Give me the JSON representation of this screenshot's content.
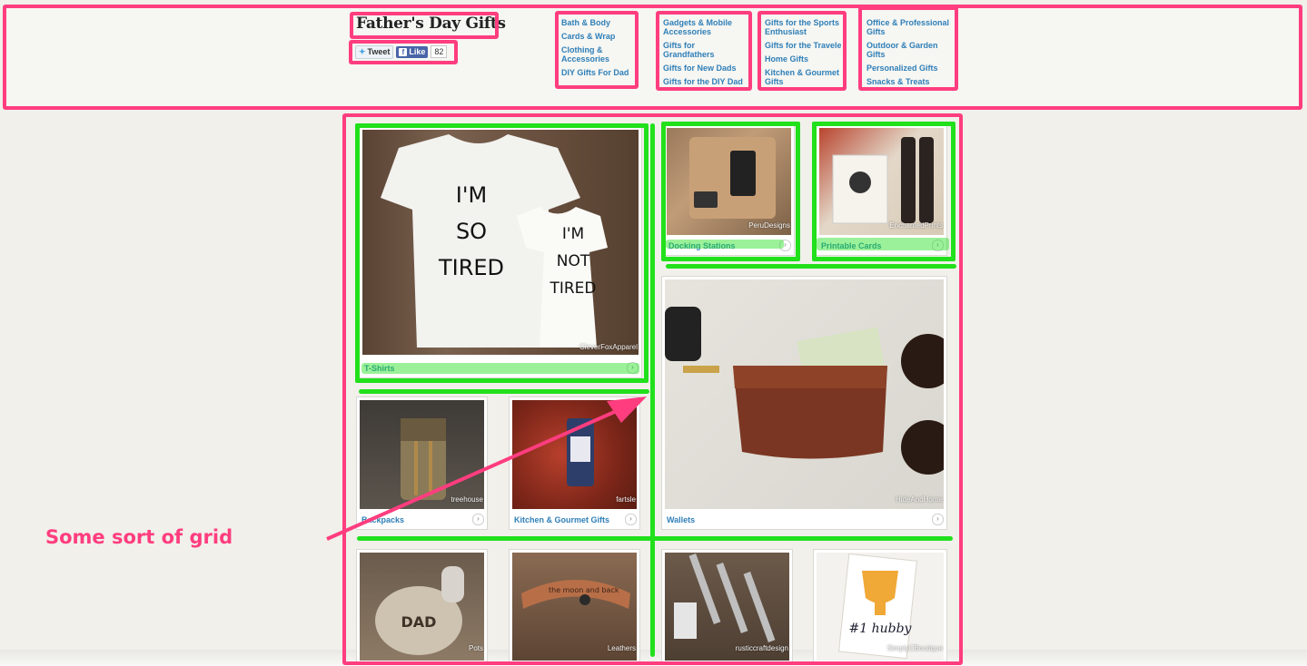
{
  "header": {
    "site_title": "Father's Day Gifts",
    "tweet_label": "Tweet",
    "like_label": "Like",
    "like_count": "82"
  },
  "nav": {
    "col1": [
      "Bath & Body",
      "Cards & Wrap",
      "Clothing & Accessories",
      "DIY Gifts For Dad"
    ],
    "col2": [
      "Gadgets & Mobile Accessories",
      "Gifts for Grandfathers",
      "Gifts for New Dads",
      "Gifts for the DIY Dad"
    ],
    "col3": [
      "Gifts for the Sports Enthusiast",
      "Gifts for the Traveler",
      "Home Gifts",
      "Kitchen & Gourmet Gifts"
    ],
    "col4": [
      "Office & Professional Gifts",
      "Outdoor & Garden Gifts",
      "Personalized Gifts",
      "Snacks & Treats"
    ]
  },
  "tiles": {
    "tshirts": {
      "label": "T-Shirts",
      "credit": "CleverFoxApparel",
      "shirt_big": "I'M SO TIRED",
      "shirt_small": "I'M NOT TIRED"
    },
    "docking": {
      "label": "Docking Stations",
      "credit": "PeruDesigns"
    },
    "cards": {
      "label": "Printable Cards",
      "credit": "EnchantedPrints"
    },
    "wallets": {
      "label": "Wallets",
      "credit": "HideAndHome"
    },
    "backpacks": {
      "label": "Backpacks",
      "credit": "treehouse"
    },
    "kitchen": {
      "label": "Kitchen & Gourmet Gifts",
      "credit": "fartsle"
    },
    "row3_1": {
      "credit": "Pots"
    },
    "row3_2": {
      "credit": "Leathers",
      "band_text": "the moon and back"
    },
    "row3_3": {
      "credit": "rusticcraftdesign"
    },
    "row3_4": {
      "credit": "SimplyCBoutique",
      "card_text": "#1 hubby"
    }
  },
  "annotation": {
    "text": "Some sort of grid"
  },
  "colors": {
    "highlight_pink": "#ff3d7f",
    "highlight_green": "#22e01c",
    "link_blue": "#2f7fb8",
    "page_bg": "#f1f0eb"
  }
}
